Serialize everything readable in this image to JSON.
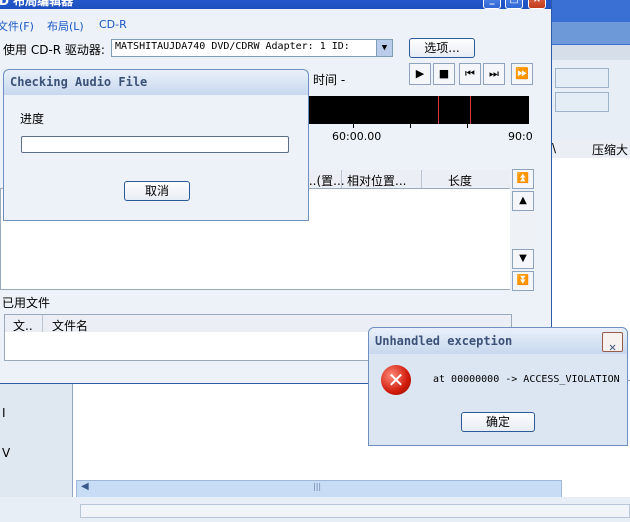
{
  "main_window": {
    "title": "D 布局编辑器",
    "menu": [
      "文件(F)",
      "布局(L)",
      "CD-R"
    ],
    "drive_label": "使用 CD-R 驱动器:",
    "drive_value": "MATSHITAUJDA740 DVD/CDRW   Adapter: 1  ID:",
    "options_button": "选项...",
    "time_label": "时间  -",
    "ruler_labels": [
      "60:00.00",
      "90:0"
    ],
    "track_columns": [
      "...(置...",
      "相对位置...",
      "长度"
    ],
    "used_files_label": "已用文件",
    "used_columns": [
      "文..",
      "文件名"
    ]
  },
  "background_app": {
    "right_header_items": [
      "\\",
      "压缩大"
    ],
    "left_fragments": [
      "I",
      "V"
    ]
  },
  "checking_dialog": {
    "title": "Checking Audio File",
    "progress_label": "进度",
    "progress_value": 0,
    "cancel_button": "取消"
  },
  "error_dialog": {
    "title": "Unhandled exception",
    "message": "at 00000000 -> ACCESS_VIOLATION",
    "ok_button": "确定"
  },
  "player_buttons": [
    "play-icon",
    "stop-icon",
    "rewind-icon",
    "fast-forward-icon",
    "skip-icon"
  ]
}
